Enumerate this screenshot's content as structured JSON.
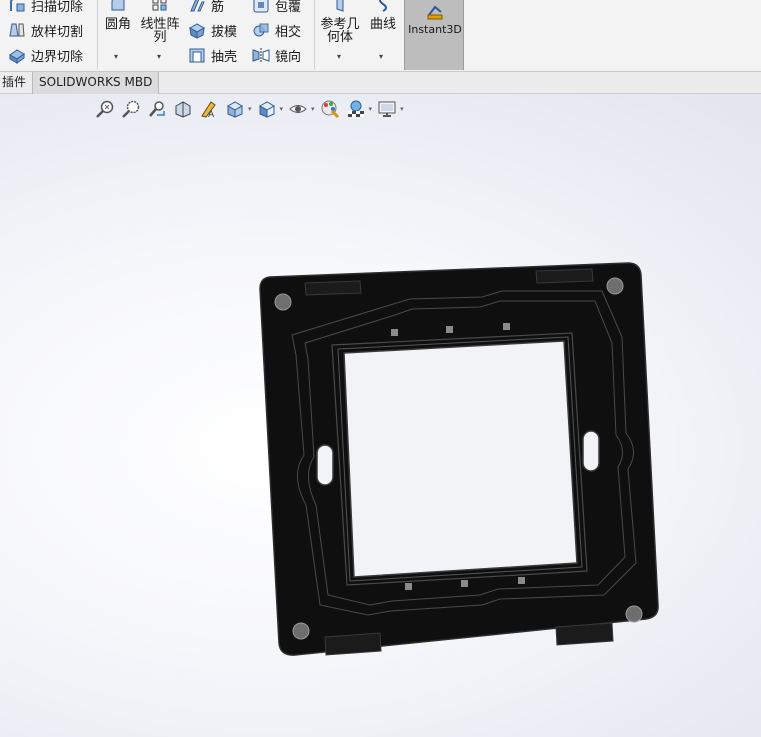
{
  "ribbon": {
    "col1": [
      {
        "icon": "sweep-cut-icon",
        "label": "扫描切除"
      },
      {
        "icon": "loft-cut-icon",
        "label": "放样切割"
      },
      {
        "icon": "boundary-cut-icon",
        "label": "边界切除"
      }
    ],
    "fillet": {
      "icon": "fillet-icon",
      "label": "圆角"
    },
    "linear_pattern": {
      "icon": "linear-pattern-icon",
      "label_line1": "线性阵",
      "label_line2": "列"
    },
    "col4": [
      {
        "icon": "rib-icon",
        "label": "筋"
      },
      {
        "icon": "draft-icon",
        "label": "拔模"
      },
      {
        "icon": "shell-icon",
        "label": "抽壳"
      }
    ],
    "col5": [
      {
        "icon": "wrap-icon",
        "label": "包覆"
      },
      {
        "icon": "intersect-icon",
        "label": "相交"
      },
      {
        "icon": "mirror-icon",
        "label": "镜向"
      }
    ],
    "ref_geometry": {
      "icon": "reference-geometry-icon",
      "label_line1": "参考几",
      "label_line2": "何体"
    },
    "curves": {
      "icon": "curves-icon",
      "label": "曲线"
    },
    "instant3d": {
      "icon": "instant3d-icon",
      "label": "Instant3D"
    },
    "caret": "▾"
  },
  "tabs": [
    {
      "label": "插件"
    },
    {
      "label": "SOLIDWORKS MBD"
    }
  ],
  "heads_up_toolbar": {
    "caret": "▾",
    "tools": [
      "zoom-to-fit-icon",
      "zoom-to-area-icon",
      "previous-view-icon",
      "section-view-icon",
      "dynamic-annotation-icon",
      "view-orientation-icon",
      "display-style-icon",
      "hide-show-items-icon",
      "edit-appearance-icon",
      "apply-scene-icon",
      "view-settings-icon"
    ]
  },
  "colors": {
    "part": "#0f0f0f",
    "part_edge": "#2e2e2e",
    "instant3d_active": "#bdbdbd"
  }
}
